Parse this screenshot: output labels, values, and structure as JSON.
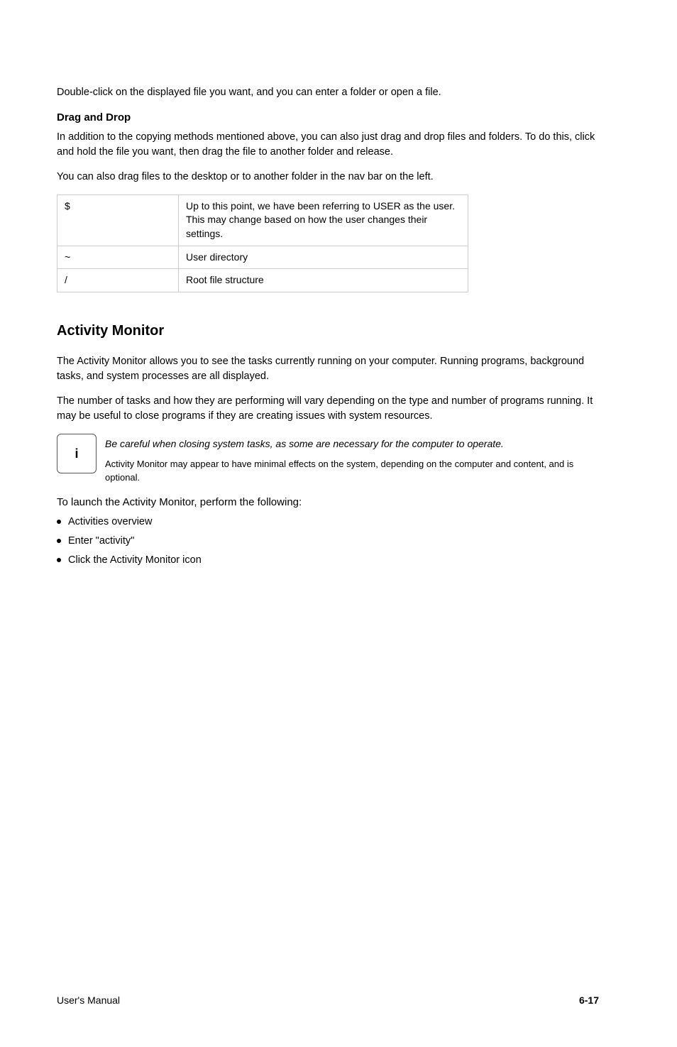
{
  "intro_para": "Double-click on the displayed file you want, and you can enter a folder or open a file.",
  "dnd_heading": "Drag and Drop",
  "dnd_para1": "In addition to the copying methods mentioned above, you can also just drag and drop files and folders. To do this, click and hold the file you want, then drag the file to another folder and release.",
  "dnd_para2": "You can also drag files to the desktop or to another folder in the nav bar on the left.",
  "table": {
    "r1": {
      "term": "$",
      "def": "Up to this point, we have been referring to USER as the user. This may change based on how the user changes their settings."
    },
    "r2": {
      "term": "~",
      "def": "User directory"
    },
    "r3": {
      "term": "/",
      "def": "Root file structure"
    }
  },
  "section_title": "Activity Monitor",
  "am_para1": "The Activity Monitor allows you to see the tasks currently running on your computer. Running programs, background tasks, and system processes are all displayed.",
  "am_para2": "The number of tasks and how they are performing will vary depending on the type and number of programs running. It may be useful to close programs if they are creating issues with system resources.",
  "note": {
    "badge": "i",
    "text": "Be careful when closing system tasks, as some are necessary for the computer to operate.",
    "footnote": "Activity Monitor may appear to have minimal effects on the system, depending on the computer and content, and is optional."
  },
  "launch_heading": "To launch the Activity Monitor, perform the following:",
  "launch_steps": [
    "Activities overview",
    "Enter \"activity\"",
    "Click the Activity Monitor icon"
  ],
  "footer": {
    "left": "User's Manual",
    "right": "6-17"
  }
}
